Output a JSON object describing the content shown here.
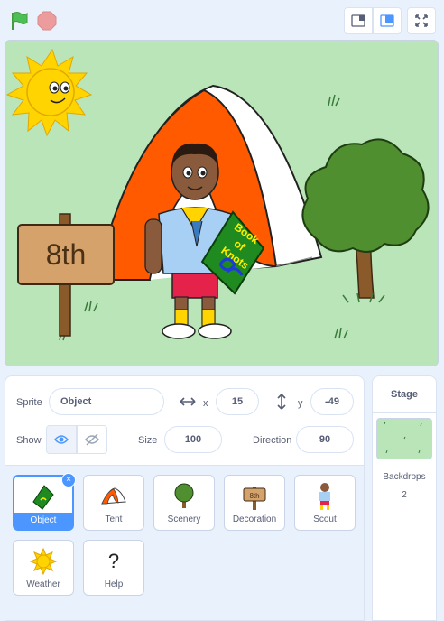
{
  "controls": {
    "green_flag": "green-flag-icon",
    "stop": "stop-sign-icon"
  },
  "view_modes": [
    "small-stage-icon",
    "large-stage-icon",
    "fullscreen-icon"
  ],
  "stage_art": {
    "sign_text": "8th",
    "book_text": [
      "Book",
      "of",
      "Knots"
    ]
  },
  "sprite_info": {
    "sprite_label": "Sprite",
    "sprite_name": "Object",
    "x_label": "x",
    "x_value": "15",
    "y_label": "y",
    "y_value": "-49",
    "show_label": "Show",
    "size_label": "Size",
    "size_value": "100",
    "direction_label": "Direction",
    "direction_value": "90"
  },
  "sprites": [
    {
      "name": "Object",
      "selected": true
    },
    {
      "name": "Tent"
    },
    {
      "name": "Scenery"
    },
    {
      "name": "Decoration"
    },
    {
      "name": "Scout"
    },
    {
      "name": "Weather"
    },
    {
      "name": "Help"
    }
  ],
  "help_glyph": "?",
  "stage_panel": {
    "title": "Stage",
    "backdrops_label": "Backdrops",
    "backdrops_count": "2"
  },
  "colors": {
    "accent": "#4c97ff",
    "stage_bg": "#b9e5b9",
    "flag": "#4cbf56",
    "stop": "#ec9c9c"
  }
}
